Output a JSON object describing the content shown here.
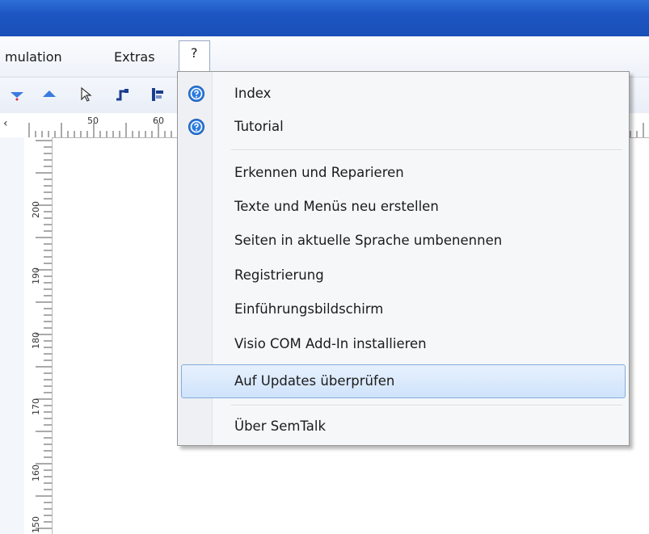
{
  "menubar": {
    "items": [
      {
        "label": "mulation"
      },
      {
        "label": "Extras"
      },
      {
        "label": "?"
      }
    ]
  },
  "ruler": {
    "h_labels": [
      "50",
      "60"
    ],
    "v_labels": [
      "200",
      "190",
      "180",
      "170",
      "160",
      "150"
    ]
  },
  "help_menu": {
    "items": [
      {
        "label": "Index",
        "icon": "help-circle-icon"
      },
      {
        "label": "Tutorial",
        "icon": "help-circle-icon"
      },
      {
        "label": "Erkennen und Reparieren"
      },
      {
        "label": "Texte und Menüs neu erstellen"
      },
      {
        "label": "Seiten in aktuelle Sprache umbenennen"
      },
      {
        "label": "Registrierung"
      },
      {
        "label": "Einführungsbildschirm"
      },
      {
        "label": "Visio COM Add-In installieren"
      },
      {
        "label": "Auf Updates überprüfen",
        "state": "highlighted"
      },
      {
        "label": "Über SemTalk"
      }
    ]
  },
  "colors": {
    "titlebar": "#1d55c2",
    "highlight_border": "#84acdd",
    "help_icon": "#1f6fd1"
  }
}
